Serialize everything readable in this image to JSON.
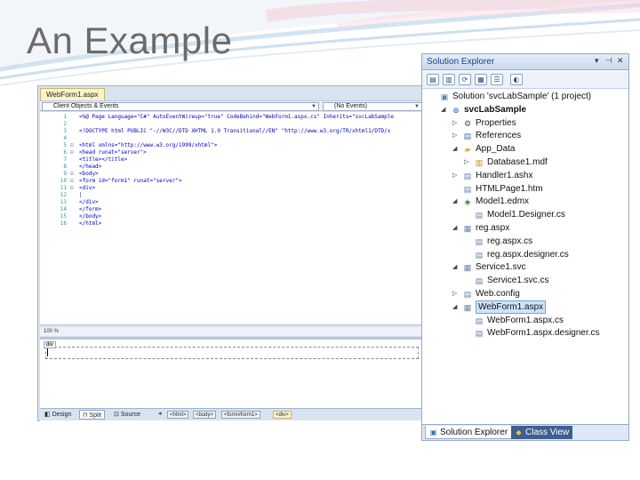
{
  "slide": {
    "title": "An Example"
  },
  "editor": {
    "doc_tab": "WebForm1.aspx",
    "left_dropdown": "Client Objects & Events",
    "right_dropdown": "(No Events)",
    "code_lines": [
      {
        "num": "1",
        "fold": "",
        "text": "<%@ Page Language=\"C#\" AutoEventWireup=\"true\" CodeBehind=\"WebForm1.aspx.cs\" Inherits=\"svcLabSample"
      },
      {
        "num": "2",
        "fold": "",
        "text": ""
      },
      {
        "num": "3",
        "fold": "",
        "text": "<!DOCTYPE html PUBLIC \"-//W3C//DTD XHTML 1.0 Transitional//EN\" \"http://www.w3.org/TR/xhtml1/DTD/x"
      },
      {
        "num": "4",
        "fold": "",
        "text": ""
      },
      {
        "num": "5",
        "fold": "⊟",
        "text": "<html xmlns=\"http://www.w3.org/1999/xhtml\">"
      },
      {
        "num": "6",
        "fold": "⊟",
        "text": "<head runat=\"server\">"
      },
      {
        "num": "7",
        "fold": "",
        "text": "    <title></title>"
      },
      {
        "num": "8",
        "fold": "",
        "text": "</head>"
      },
      {
        "num": "9",
        "fold": "⊟",
        "text": "<body>"
      },
      {
        "num": "10",
        "fold": "⊟",
        "text": "    <form id=\"form1\" runat=\"server\">"
      },
      {
        "num": "11",
        "fold": "⊟",
        "text": "    <div>"
      },
      {
        "num": "12",
        "fold": "",
        "text": "      |"
      },
      {
        "num": "13",
        "fold": "",
        "text": "    </div>"
      },
      {
        "num": "14",
        "fold": "",
        "text": "    </form>"
      },
      {
        "num": "15",
        "fold": "",
        "text": "</body>"
      },
      {
        "num": "16",
        "fold": "",
        "text": "</html>"
      }
    ],
    "zoom": "100 %",
    "design_tag": "div",
    "views": {
      "design": "Design",
      "split": "Split",
      "source": "Source"
    },
    "breadcrumbs": [
      "<html>",
      "<body>",
      "<form#form1>",
      "<div>"
    ]
  },
  "solution_explorer": {
    "title": "Solution Explorer",
    "items": [
      {
        "label": "Solution 'svcLabSample' (1 project)",
        "indent": 0,
        "twisty": "",
        "icon": "solution-icon",
        "glyph": "▣",
        "color": "#5b7fb5"
      },
      {
        "label": "svcLabSample",
        "indent": 1,
        "twisty": "◢",
        "icon": "web-project-icon",
        "glyph": "⊕",
        "color": "#2b6cb0",
        "bold": true
      },
      {
        "label": "Properties",
        "indent": 2,
        "twisty": "▷",
        "icon": "properties-icon",
        "glyph": "⚙",
        "color": "#555555"
      },
      {
        "label": "References",
        "indent": 2,
        "twisty": "▷",
        "icon": "references-icon",
        "glyph": "▤",
        "color": "#4a6fa5"
      },
      {
        "label": "App_Data",
        "indent": 2,
        "twisty": "◢",
        "icon": "folder-icon",
        "glyph": "▰",
        "color": "#d9b44a"
      },
      {
        "label": "Database1.mdf",
        "indent": 3,
        "twisty": "▷",
        "icon": "database-icon",
        "glyph": "▥",
        "color": "#c08a2a"
      },
      {
        "label": "Handler1.ashx",
        "indent": 2,
        "twisty": "▷",
        "icon": "handler-file-icon",
        "glyph": "▤",
        "color": "#6a7fa8"
      },
      {
        "label": "HTMLPage1.htm",
        "indent": 2,
        "twisty": "",
        "icon": "html-file-icon",
        "glyph": "▤",
        "color": "#6a7fa8"
      },
      {
        "label": "Model1.edmx",
        "indent": 2,
        "twisty": "◢",
        "icon": "edmx-file-icon",
        "glyph": "◈",
        "color": "#3a7a3a"
      },
      {
        "label": "Model1.Designer.cs",
        "indent": 3,
        "twisty": "",
        "icon": "cs-file-icon",
        "glyph": "▤",
        "color": "#6a7fa8"
      },
      {
        "label": "reg.aspx",
        "indent": 2,
        "twisty": "◢",
        "icon": "aspx-file-icon",
        "glyph": "▦",
        "color": "#6a7fa8"
      },
      {
        "label": "reg.aspx.cs",
        "indent": 3,
        "twisty": "",
        "icon": "cs-file-icon",
        "glyph": "▤",
        "color": "#6a7fa8"
      },
      {
        "label": "reg.aspx.designer.cs",
        "indent": 3,
        "twisty": "",
        "icon": "cs-file-icon",
        "glyph": "▤",
        "color": "#6a7fa8"
      },
      {
        "label": "Service1.svc",
        "indent": 2,
        "twisty": "◢",
        "icon": "svc-file-icon",
        "glyph": "▦",
        "color": "#6a7fa8"
      },
      {
        "label": "Service1.svc.cs",
        "indent": 3,
        "twisty": "",
        "icon": "cs-file-icon",
        "glyph": "▤",
        "color": "#6a7fa8"
      },
      {
        "label": "Web.config",
        "indent": 2,
        "twisty": "▷",
        "icon": "config-file-icon",
        "glyph": "▤",
        "color": "#6a7fa8"
      },
      {
        "label": "WebForm1.aspx",
        "indent": 2,
        "twisty": "◢",
        "icon": "aspx-file-icon",
        "glyph": "▦",
        "color": "#6a7fa8",
        "selected": true
      },
      {
        "label": "WebForm1.aspx.cs",
        "indent": 3,
        "twisty": "",
        "icon": "cs-file-icon",
        "glyph": "▤",
        "color": "#6a7fa8"
      },
      {
        "label": "WebForm1.aspx.designer.cs",
        "indent": 3,
        "twisty": "",
        "icon": "cs-file-icon",
        "glyph": "▤",
        "color": "#6a7fa8"
      }
    ],
    "tabs": {
      "solution": "Solution Explorer",
      "class": "Class View"
    }
  },
  "colors": {
    "accent": "#15428b",
    "selection": "#cfe3fb",
    "tab_dark": "#3f5f8f"
  }
}
